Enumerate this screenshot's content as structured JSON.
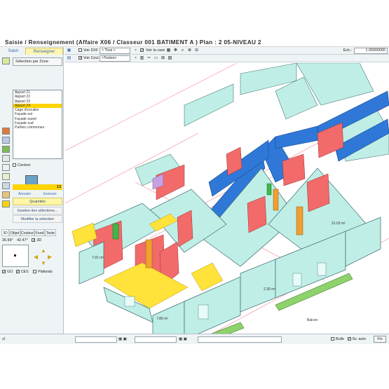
{
  "window": {
    "title": "Saisie / Renseignement   (Affaire X06 / Classeur 001 BATIMENT A )  Plan : 2 05-NIVEAU 2"
  },
  "left_panel": {
    "tabs": [
      "Saisir",
      "Renseigner"
    ],
    "active_tab": "Renseigner",
    "selection_mode": "Sélection par Zone",
    "zones": [
      {
        "label": "Appart 21",
        "selected": false
      },
      {
        "label": "Appart 22",
        "selected": false
      },
      {
        "label": "Appart 23",
        "selected": false
      },
      {
        "label": "Appart 24",
        "selected": true
      },
      {
        "label": "Cage d'escalier",
        "selected": false
      },
      {
        "label": "Façade est",
        "selected": false
      },
      {
        "label": "Façade ouest",
        "selected": false
      },
      {
        "label": "Façade sud",
        "selected": false
      },
      {
        "label": "Parties communes",
        "selected": false
      }
    ],
    "centrer_label": "Centrer",
    "count": "13",
    "annuler_label": "Annuler",
    "inverser_label": "Inverser",
    "quantites_label": "Quantités",
    "gestion_label": "Gestion des sélections...",
    "modifier_label": "Modifier la sélection",
    "subtabs": [
      "3D",
      "Objet",
      "Couleur",
      "Fond",
      "Texte"
    ],
    "angle_1": "36.99°",
    "angle_2": "42.47°",
    "view_3d_label": "3D",
    "go_label": "GO",
    "ces_label": "CES",
    "plafonds_label": "Plafonds"
  },
  "toolbar": {
    "voir_dxf_label": "Voir DXF",
    "voir_dxf_value": "< Tous >",
    "voir_coul_label": "Voir Coul.",
    "voir_coul_value": "<Toutes>",
    "voir_cave_label": "Voir la cave",
    "echelle_label": "Ech.:",
    "echelle_value": "1.00000000"
  },
  "drawing": {
    "labels": [
      "7.91 m²",
      "7.86 m²",
      "2.35 m²",
      "31.03 m²",
      "Balcon"
    ]
  },
  "statusbar": {
    "bulle_label": "Bulle",
    "sv_auto_label": "Sv. auto",
    "fin_label": "Fin"
  },
  "colors": {
    "selection_yellow": "#ffd400",
    "wall_cyan": "#bfeee6",
    "wall_blue": "#2f78d8",
    "wall_red": "#f26a6a",
    "balcony_green": "#8fd26c",
    "accent_orange": "#f0a030"
  }
}
